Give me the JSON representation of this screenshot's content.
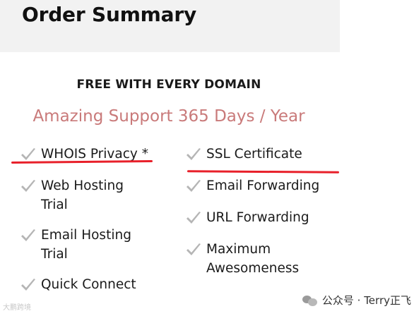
{
  "header": {
    "title": "Order Summary"
  },
  "free_heading": "FREE WITH EVERY DOMAIN",
  "support_text": "Amazing Support 365 Days / Year",
  "features_left": [
    {
      "label": "WHOIS Privacy *"
    },
    {
      "label": "Web Hosting Trial"
    },
    {
      "label": "Email Hosting Trial"
    },
    {
      "label": "Quick Connect"
    }
  ],
  "features_right": [
    {
      "label": "SSL Certificate"
    },
    {
      "label": "Email Forwarding"
    },
    {
      "label": "URL Forwarding"
    },
    {
      "label": "Maximum Awesomeness"
    }
  ],
  "watermark": {
    "left": "大鹏跨境",
    "right": "公众号 · Terry正飞"
  },
  "colors": {
    "support": "#c97a7a",
    "check": "#b5b5b5",
    "underline": "#e8202a",
    "header_bg": "#f2f2f2"
  }
}
